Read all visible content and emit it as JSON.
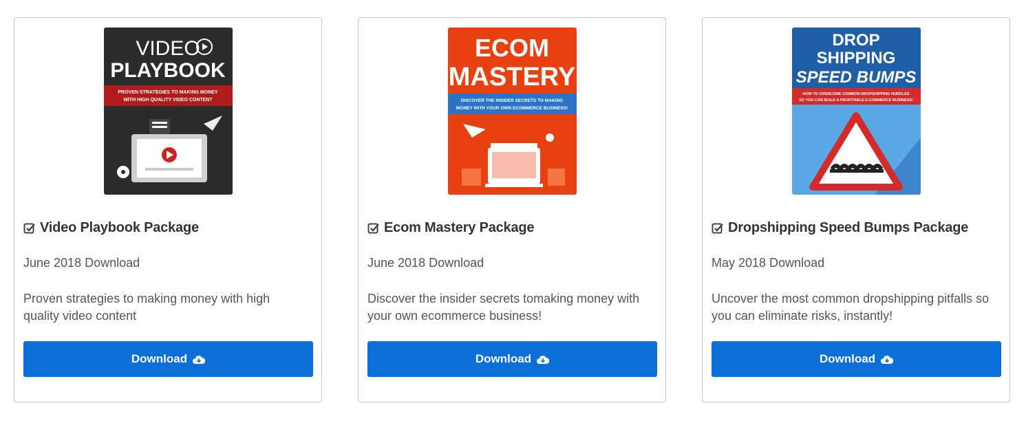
{
  "cards": [
    {
      "cover": {
        "line1": "VIDEO",
        "line2": "PLAYBOOK",
        "tagline1": "PROVEN STRATEGIES TO MAKING MONEY",
        "tagline2": "WITH HIGH QUALITY VIDEO CONTENT",
        "bg": "#2b2b2b",
        "band": "#b01c1c"
      },
      "title": "Video Playbook Package",
      "date": "June 2018 Download",
      "description": "Proven strategies to making money with high quality video content",
      "button_label": "Download"
    },
    {
      "cover": {
        "line1": "ECOM",
        "line2": "MASTERY",
        "tagline1": "DISCOVER THE INSIDER SECRETS TO MAKING",
        "tagline2": "MONEY WITH YOUR OWN ECOMMERCE BUSINESS!",
        "bg": "#e8400f",
        "band": "#2a73c9"
      },
      "title": "Ecom Mastery Package",
      "date": "June 2018 Download",
      "description": "Discover the insider secrets tomaking money with your own ecommerce business!",
      "button_label": "Download"
    },
    {
      "cover": {
        "line1": "DROP",
        "line2": "SHIPPING",
        "line3": "SPEED BUMPS",
        "tagline1": "HOW TO OVERCOME COMMON DROPSHIPPING HURDLES",
        "tagline2": "SO YOU CAN BUILD A PROFITABLE E-COMMERCE BUSINESS!",
        "bg": "#5aa8e6",
        "band": "#d42a2a"
      },
      "title": "Dropshipping Speed Bumps Package",
      "date": "May 2018 Download",
      "description": "Uncover the most common dropshipping pitfalls so you can eliminate risks, instantly!",
      "button_label": "Download"
    }
  ],
  "colors": {
    "button": "#0a6fd6",
    "border": "#c8c8c8",
    "title_text": "#333333",
    "body_text": "#555555"
  },
  "icons": {
    "title": "check-square-icon",
    "button": "cloud-download-icon"
  }
}
